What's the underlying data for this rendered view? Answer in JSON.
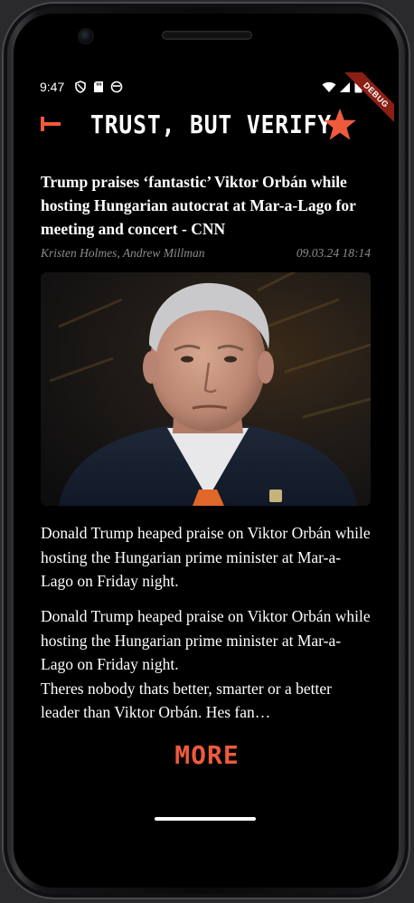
{
  "status_bar": {
    "time": "9:47",
    "debug_label": "DEBUG"
  },
  "app_bar": {
    "title": "TRUST, BUT VERIFY",
    "accent_color": "#ef5a3c"
  },
  "article": {
    "headline": "Trump praises ‘fantastic’ Viktor Orbán while hosting Hungarian autocrat at Mar-a-Lago for meeting and concert - CNN",
    "authors": "Kristen Holmes, Andrew Millman",
    "date": "09.03.24 18:14",
    "summary": "Donald Trump heaped praise on Viktor Orbán while hosting the Hungarian prime minister at Mar-a-Lago on Friday night.",
    "body_line1": "Donald Trump heaped praise on Viktor Orbán while hosting the Hungarian prime minister at Mar-a-Lago on Friday night.",
    "body_line2": "Theres nobody thats better, smarter or a better leader than Viktor Orbán. Hes fan…",
    "more_label": "MORE"
  }
}
